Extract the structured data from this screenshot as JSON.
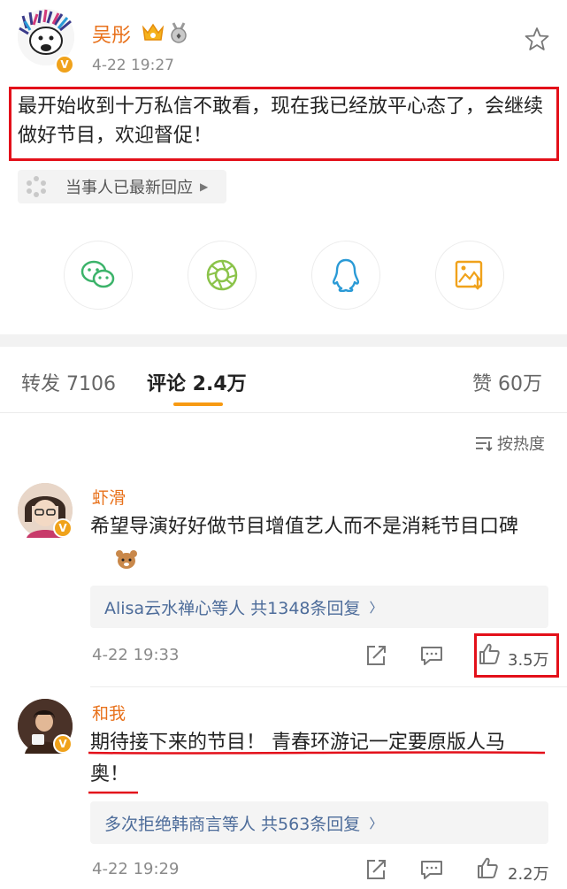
{
  "post": {
    "username": "吴彤",
    "verified_badge": "V",
    "time": "4-22 19:27",
    "text": "最开始收到十万私信不敢看，现在我已经放平心态了，会继续做好节目，欢迎督促！",
    "update_pill": "当事人已最新回应"
  },
  "share_icons": [
    "wechat-icon",
    "moments-icon",
    "qq-icon",
    "save-image-icon"
  ],
  "tabs": {
    "repost": "转发 7106",
    "comments": "评论 2.4万",
    "likes": "赞 60万"
  },
  "sort_label": "按热度",
  "comments": [
    {
      "name": "虾滑",
      "text": "希望导演好好做节目增值艺人而不是消耗节目口碑",
      "replies": "Alisa云水禅心等人 共1348条回复",
      "time": "4-22 19:33",
      "likes": "3.5万"
    },
    {
      "name": "和我",
      "text_line1": "期待接下来的节目！ 青春环游记一定要原版人马",
      "text_line2": "奥！",
      "replies": "多次拒绝韩商言等人 共563条回复",
      "time": "4-22 19:29",
      "likes": "2.2万"
    }
  ],
  "colors": {
    "accent_orange": "#e8711b",
    "highlight_red": "#e3101a",
    "tab_underline": "#f79a12",
    "reply_link": "#4d6c9a"
  }
}
